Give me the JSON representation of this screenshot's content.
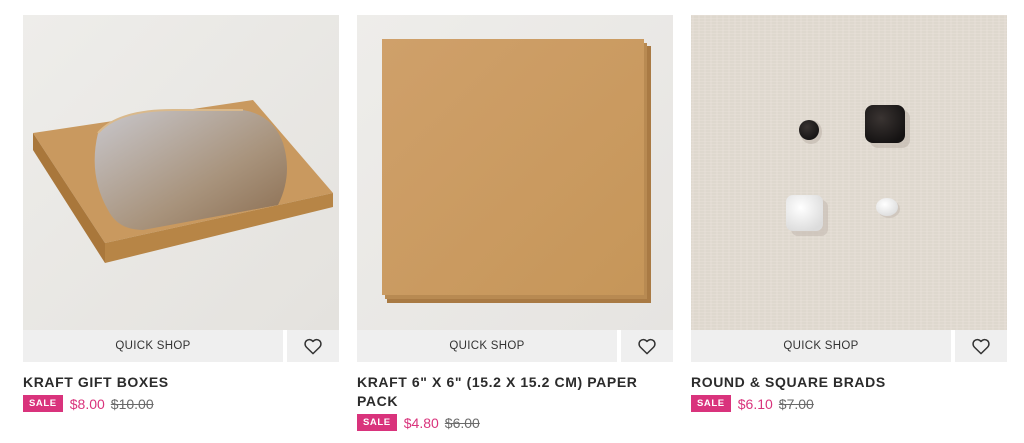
{
  "products": [
    {
      "title": "KRAFT GIFT BOXES",
      "quick_shop": "QUICK SHOP",
      "badge": "SALE",
      "sale_price": "$8.00",
      "original_price": "$10.00"
    },
    {
      "title": "KRAFT 6\" X 6\" (15.2 X 15.2 CM) PAPER PACK",
      "quick_shop": "QUICK SHOP",
      "badge": "SALE",
      "sale_price": "$4.80",
      "original_price": "$6.00"
    },
    {
      "title": "ROUND & SQUARE BRADS",
      "quick_shop": "QUICK SHOP",
      "badge": "SALE",
      "sale_price": "$6.10",
      "original_price": "$7.00"
    }
  ],
  "colors": {
    "sale_accent": "#d9337c",
    "button_bg": "#efefef",
    "kraft": "#c99a63"
  },
  "icons": {
    "favorite": "heart-outline-icon"
  }
}
